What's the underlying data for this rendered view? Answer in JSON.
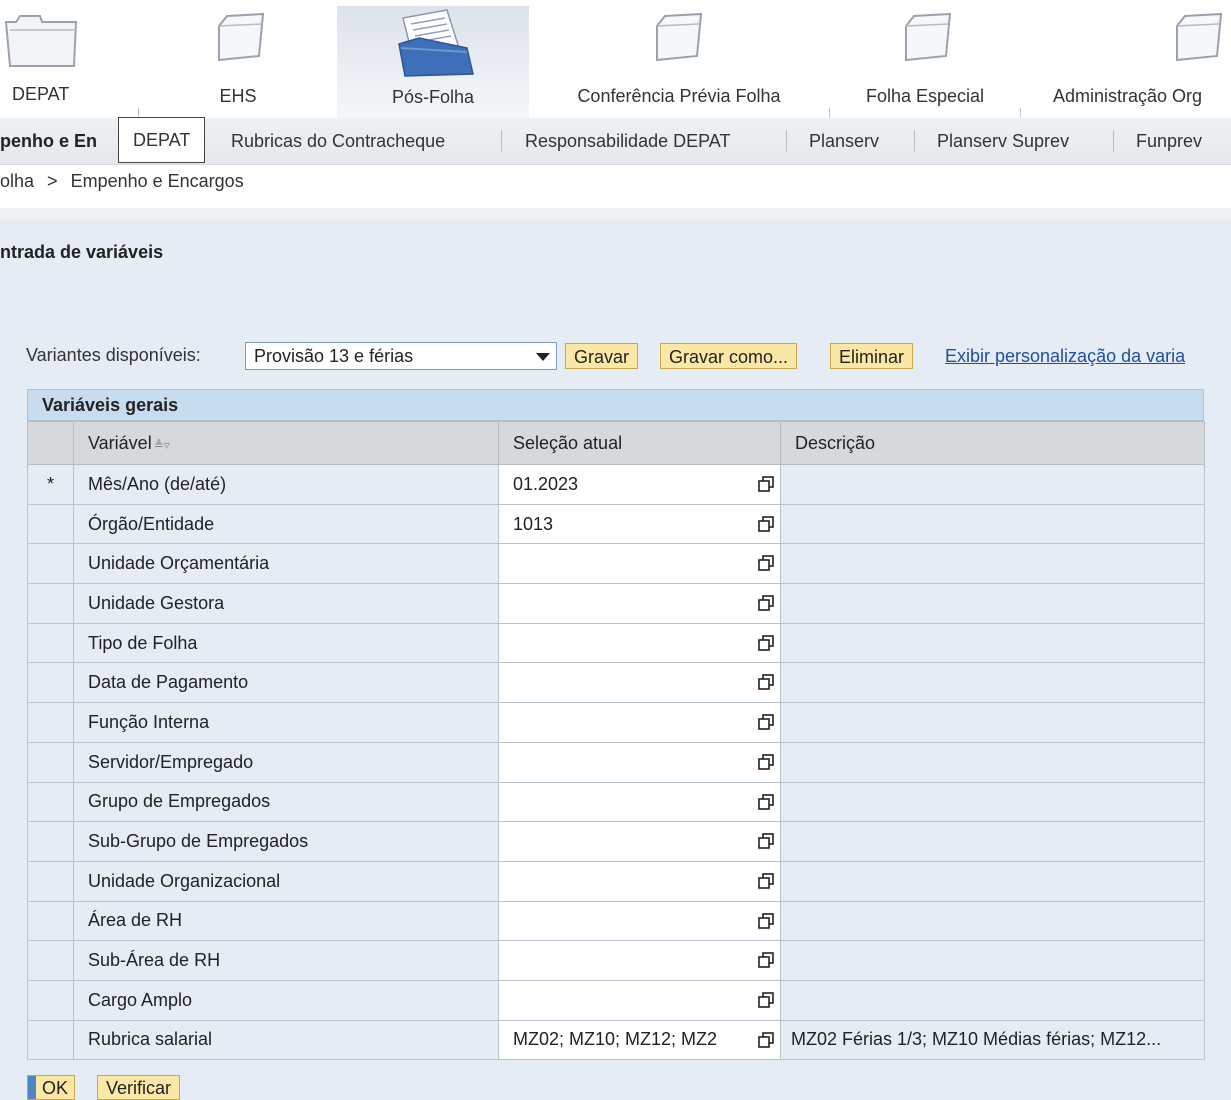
{
  "topnav": {
    "tabs": [
      {
        "label": "DEPAT",
        "icon": "folder-icon"
      },
      {
        "label": "EHS",
        "icon": "folder-icon"
      },
      {
        "label": "Pós-Folha",
        "icon": "document-folder-icon",
        "active": true
      },
      {
        "label": "Conferência Prévia Folha",
        "icon": "folder-icon"
      },
      {
        "label": "Folha Especial",
        "icon": "folder-icon"
      },
      {
        "label": "Administração Org",
        "icon": "folder-icon"
      }
    ]
  },
  "subnav": {
    "items": [
      {
        "label": "penho e En"
      },
      {
        "label": "Rubricas do Contracheque"
      },
      {
        "label": "Responsabilidade DEPAT"
      },
      {
        "label": "Planserv"
      },
      {
        "label": "Planserv Suprev"
      },
      {
        "label": "Funprev"
      }
    ],
    "tooltip": "DEPAT"
  },
  "breadcrumb": {
    "parent": "olha",
    "separator": ">",
    "current": "Empenho e Encargos"
  },
  "page": {
    "title": "ntrada de variáveis"
  },
  "variants": {
    "label": "Variantes disponíveis:",
    "selected": "Provisão 13 e férias",
    "save": "Gravar",
    "save_as": "Gravar como...",
    "delete": "Eliminar",
    "personalize_link": "Exibir personalização da varia"
  },
  "table": {
    "group_title": "Variáveis gerais",
    "columns": {
      "variable": "Variável",
      "selection": "Seleção atual",
      "description": "Descrição"
    },
    "rows": [
      {
        "mark": "*",
        "name": "Mês/Ano (de/até)",
        "value": "01.2023",
        "description": ""
      },
      {
        "mark": "",
        "name": "Órgão/Entidade",
        "value": "1013",
        "description": ""
      },
      {
        "mark": "",
        "name": "Unidade Orçamentária",
        "value": "",
        "description": ""
      },
      {
        "mark": "",
        "name": "Unidade Gestora",
        "value": "",
        "description": ""
      },
      {
        "mark": "",
        "name": "Tipo de Folha",
        "value": "",
        "description": ""
      },
      {
        "mark": "",
        "name": "Data de Pagamento",
        "value": "",
        "description": ""
      },
      {
        "mark": "",
        "name": "Função Interna",
        "value": "",
        "description": ""
      },
      {
        "mark": "",
        "name": "Servidor/Empregado",
        "value": "",
        "description": ""
      },
      {
        "mark": "",
        "name": "Grupo de Empregados",
        "value": "",
        "description": ""
      },
      {
        "mark": "",
        "name": "Sub-Grupo de Empregados",
        "value": "",
        "description": ""
      },
      {
        "mark": "",
        "name": "Unidade Organizacional",
        "value": "",
        "description": ""
      },
      {
        "mark": "",
        "name": "Área de RH",
        "value": "",
        "description": ""
      },
      {
        "mark": "",
        "name": "Sub-Área de RH",
        "value": "",
        "description": ""
      },
      {
        "mark": "",
        "name": "Cargo Amplo",
        "value": "",
        "description": ""
      },
      {
        "mark": "",
        "name": "Rubrica salarial",
        "value": "MZ02; MZ10; MZ12; MZ2",
        "description": "MZ02 Férias 1/3; MZ10 Médias férias; MZ12..."
      }
    ]
  },
  "footer": {
    "ok": "OK",
    "verify": "Verificar"
  }
}
